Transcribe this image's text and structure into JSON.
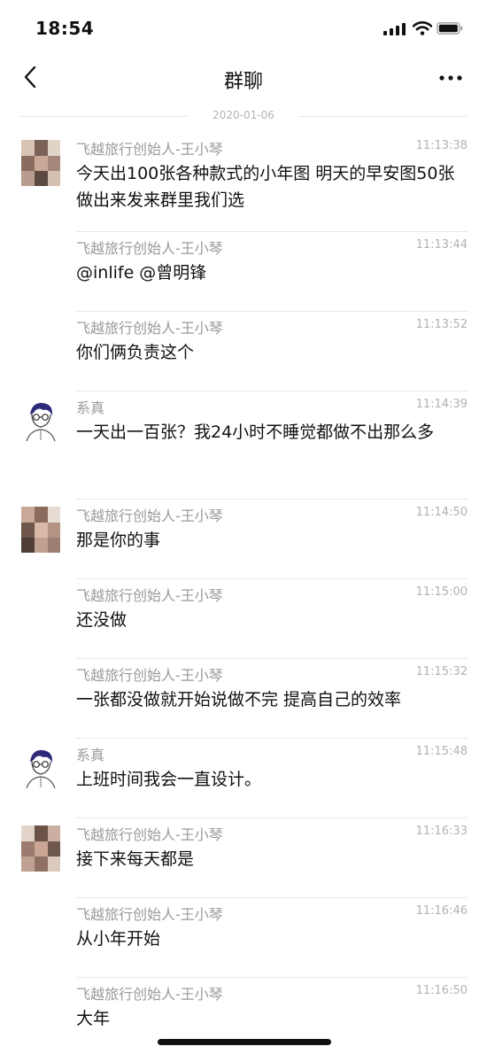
{
  "status_bar": {
    "time": "18:54"
  },
  "nav": {
    "title": "群聊"
  },
  "date_divider": "2020-01-06",
  "messages": [
    {
      "sender": "飞越旅行创始人-王小琴",
      "time": "11:13:38",
      "text": "今天出100张各种款式的小年图 明天的早安图50张 做出来发来群里我们选",
      "avatar": "photo"
    },
    {
      "sender": "飞越旅行创始人-王小琴",
      "time": "11:13:44",
      "text": "@inlife @曾明锋",
      "avatar": ""
    },
    {
      "sender": "飞越旅行创始人-王小琴",
      "time": "11:13:52",
      "text": "你们俩负责这个",
      "avatar": ""
    },
    {
      "sender": "系真",
      "time": "11:14:39",
      "text": "一天出一百张？我24小时不睡觉都做不出那么多",
      "avatar": "cartoon"
    },
    {
      "sender": "飞越旅行创始人-王小琴",
      "time": "11:14:50",
      "text": "那是你的事",
      "avatar": "photo"
    },
    {
      "sender": "飞越旅行创始人-王小琴",
      "time": "11:15:00",
      "text": "还没做",
      "avatar": ""
    },
    {
      "sender": "飞越旅行创始人-王小琴",
      "time": "11:15:32",
      "text": "一张都没做就开始说做不完 提高自己的效率",
      "avatar": ""
    },
    {
      "sender": "系真",
      "time": "11:15:48",
      "text": "上班时间我会一直设计。",
      "avatar": "cartoon"
    },
    {
      "sender": "飞越旅行创始人-王小琴",
      "time": "11:16:33",
      "text": "接下来每天都是",
      "avatar": "photo"
    },
    {
      "sender": "飞越旅行创始人-王小琴",
      "time": "11:16:46",
      "text": "从小年开始",
      "avatar": ""
    },
    {
      "sender": "飞越旅行创始人-王小琴",
      "time": "11:16:50",
      "text": "大年",
      "avatar": ""
    }
  ]
}
